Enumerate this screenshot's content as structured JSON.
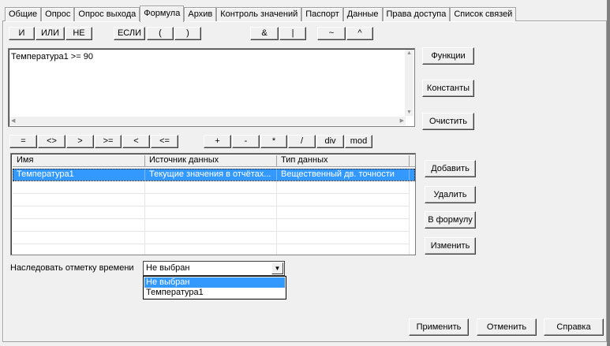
{
  "tabs": [
    {
      "label": "Общие"
    },
    {
      "label": "Опрос"
    },
    {
      "label": "Опрос выхода"
    },
    {
      "label": "Формула",
      "active": true
    },
    {
      "label": "Архив"
    },
    {
      "label": "Контроль значений"
    },
    {
      "label": "Паспорт"
    },
    {
      "label": "Данные"
    },
    {
      "label": "Права доступа"
    },
    {
      "label": "Список связей"
    }
  ],
  "logic_buttons": [
    "И",
    "ИЛИ",
    "НЕ",
    "ЕСЛИ",
    "(",
    ")",
    "&",
    "|",
    "~",
    "^"
  ],
  "editor": {
    "text": "Температура1 >= 90"
  },
  "side_buttons": {
    "functions": "Функции",
    "constants": "Константы",
    "clear": "Очистить"
  },
  "op_buttons": [
    "=",
    "<>",
    ">",
    ">=",
    "<",
    "<=",
    "+",
    "-",
    "*",
    "/",
    "div",
    "mod"
  ],
  "table": {
    "columns": [
      "Имя",
      "Источник данных",
      "Тип данных"
    ],
    "rows": [
      {
        "name": "Температура1",
        "source": "Текущие значения в отчётах...",
        "type": "Вещественный дв. точности",
        "selected": true
      }
    ]
  },
  "table_buttons": {
    "add": "Добавить",
    "delete": "Удалить",
    "to_formula": "В формулу",
    "change": "Изменить"
  },
  "inherit": {
    "label": "Наследовать отметку времени",
    "value": "Не выбран",
    "options": [
      "Не выбран",
      "Температура1"
    ]
  },
  "footer": {
    "apply": "Применить",
    "cancel": "Отменить",
    "help": "Справка"
  }
}
